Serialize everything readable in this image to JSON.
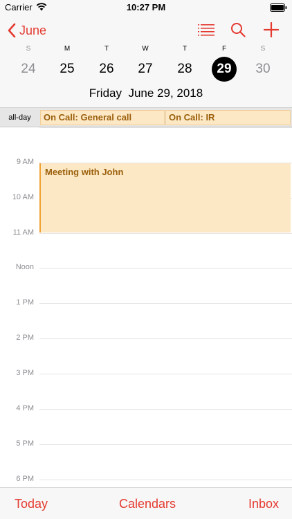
{
  "status_bar": {
    "carrier": "Carrier",
    "time": "10:27 PM"
  },
  "nav": {
    "back_label": "June",
    "icons": [
      "chevron-left-icon",
      "list-icon",
      "search-icon",
      "add-icon"
    ],
    "accent_color": "#e43a30"
  },
  "week": {
    "days": [
      {
        "letter": "S",
        "number": "24",
        "weekend": true,
        "selected": false
      },
      {
        "letter": "M",
        "number": "25",
        "weekend": false,
        "selected": false
      },
      {
        "letter": "T",
        "number": "26",
        "weekend": false,
        "selected": false
      },
      {
        "letter": "W",
        "number": "27",
        "weekend": false,
        "selected": false
      },
      {
        "letter": "T",
        "number": "28",
        "weekend": false,
        "selected": false
      },
      {
        "letter": "F",
        "number": "29",
        "weekend": false,
        "selected": true
      },
      {
        "letter": "S",
        "number": "30",
        "weekend": true,
        "selected": false
      }
    ]
  },
  "date_title": "Friday  June 29, 2018",
  "all_day": {
    "label": "all-day",
    "events": [
      "On Call: General call",
      "On Call: IR"
    ]
  },
  "timeline": {
    "hours": [
      "9 AM",
      "10 AM",
      "11 AM",
      "Noon",
      "1 PM",
      "2 PM",
      "3 PM",
      "4 PM",
      "5 PM",
      "6 PM"
    ],
    "events": [
      {
        "title": "Meeting with John",
        "start": "9 AM",
        "end": "11 AM"
      }
    ],
    "event_color": "#fde8c6"
  },
  "tabbar": {
    "today": "Today",
    "calendars": "Calendars",
    "inbox": "Inbox"
  }
}
